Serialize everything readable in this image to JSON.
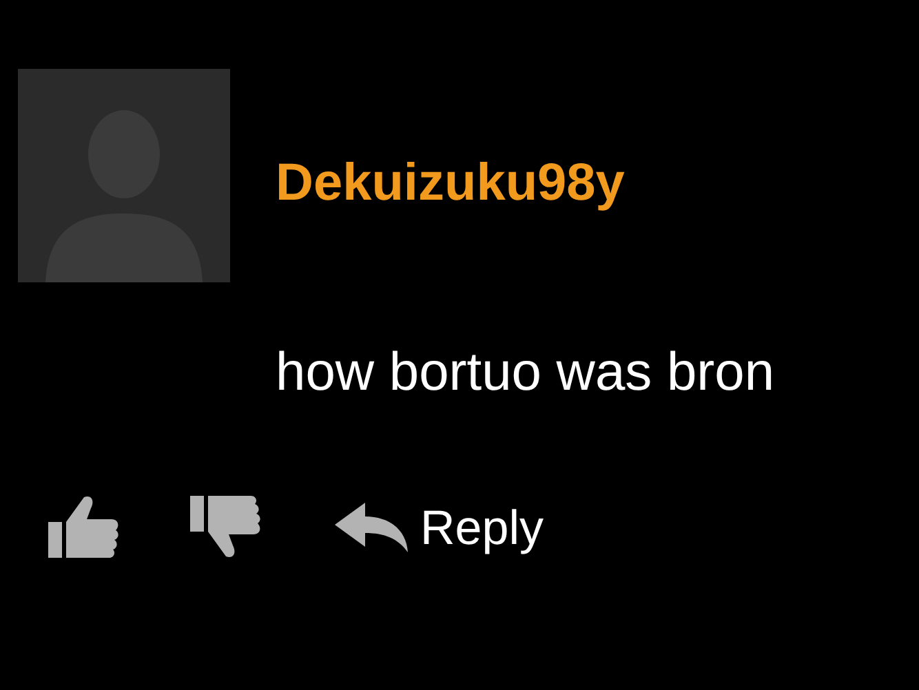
{
  "comment": {
    "username": "Dekuizuku98y",
    "text": "how bortuo was bron"
  },
  "actions": {
    "reply": "Reply"
  }
}
